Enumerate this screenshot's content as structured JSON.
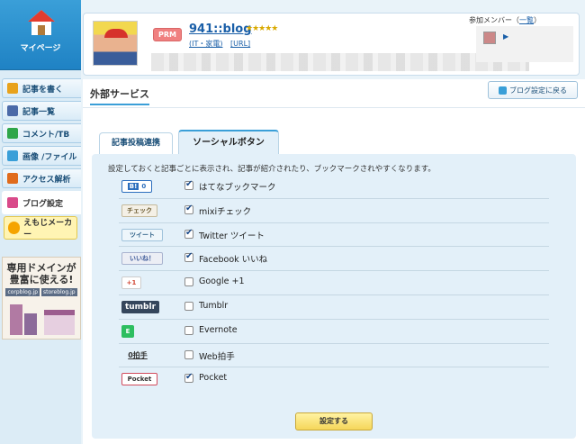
{
  "sidebar": {
    "mypage_label": "マイページ",
    "items": [
      {
        "label": "記事を書く",
        "color": "#e8a21c"
      },
      {
        "label": "記事一覧",
        "color": "#4b6aa8"
      },
      {
        "label": "コメント/TB",
        "color": "#2fa64a"
      },
      {
        "label": "画像 /ファイル",
        "color": "#3a9fd8"
      },
      {
        "label": "アクセス解析",
        "color": "#e06b1c"
      },
      {
        "label": "ブログ設定",
        "color": "#d94a8a"
      }
    ],
    "emoji_label": "えもじメーカー",
    "ad": {
      "title_line1": "専用ドメインが",
      "title_line2": "豊富に使える!",
      "domains": [
        "corpblog.jp",
        "storeblog.jp"
      ]
    }
  },
  "header": {
    "badge": "PRM",
    "blog_title": "941::blog",
    "stars": "★★★★★",
    "category": "(IT・家電)",
    "url_link": "[URL]",
    "members_label": "参加メンバー（",
    "members_link": "一覧",
    "members_close": "）"
  },
  "main": {
    "page_title": "外部サービス",
    "back_button": "ブログ設定に戻る",
    "tabs": [
      "記事投稿連携",
      "ソーシャルボタン"
    ],
    "intro": "設定しておくと記事ごとに表示され、記事が紹介されたり、ブックマークされやすくなります。",
    "services": [
      {
        "icon_text": "B! 0",
        "label": "はてなブックマーク",
        "checked": true
      },
      {
        "icon_text": "チェック",
        "label": "mixiチェック",
        "checked": true
      },
      {
        "icon_text": "ツイート",
        "label": "Twitter ツイート",
        "checked": true
      },
      {
        "icon_text": "いいね！",
        "label": "Facebook いいね",
        "checked": true
      },
      {
        "icon_text": "+1",
        "label": "Google +1",
        "checked": false
      },
      {
        "icon_text": "tumblr",
        "label": "Tumblr",
        "checked": false
      },
      {
        "icon_text": "E",
        "label": "Evernote",
        "checked": false
      },
      {
        "icon_text": "0拍手",
        "label": "Web拍手",
        "checked": false
      },
      {
        "icon_text": "Pocket",
        "label": "Pocket",
        "checked": true
      }
    ],
    "submit_label": "設定する"
  }
}
